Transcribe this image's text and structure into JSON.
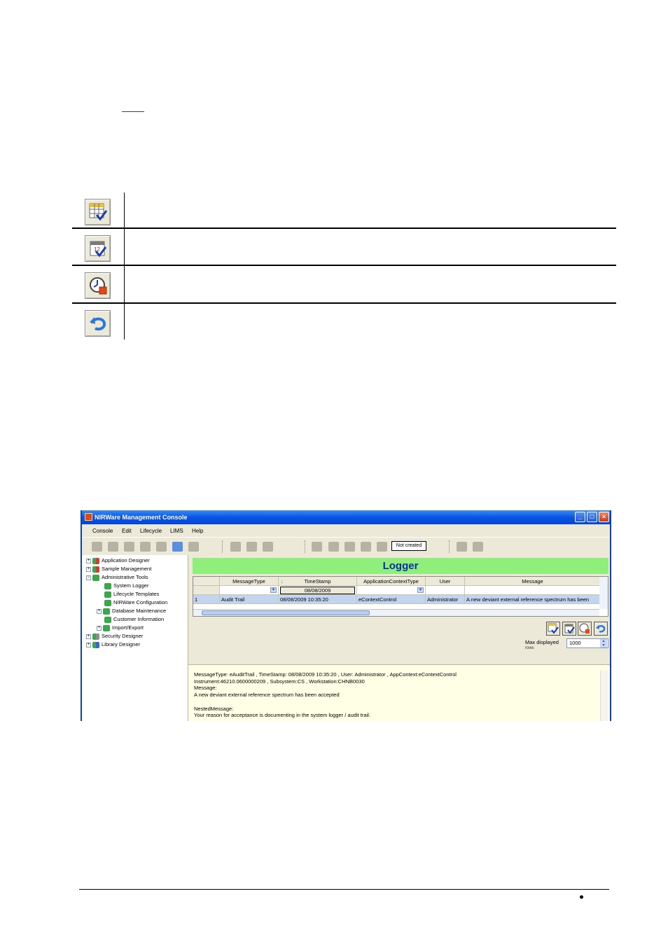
{
  "window": {
    "title": "NIRWare Management Console",
    "buttons": {
      "minimize": "_",
      "maximize": "□",
      "close": "×"
    }
  },
  "menu": [
    "Console",
    "Edit",
    "Lifecycle",
    "LIMS",
    "Help"
  ],
  "toolbar": {
    "status": "Not created"
  },
  "tree": [
    {
      "label": "Application Designer",
      "level": 0,
      "expander": "+",
      "icon": "puzzle-red"
    },
    {
      "label": "Sample Management",
      "level": 0,
      "expander": "+",
      "icon": "puzzle-red"
    },
    {
      "label": "Administrative Tools",
      "level": 0,
      "expander": "−",
      "icon": "puzzle-green"
    },
    {
      "label": "System Logger",
      "level": 1,
      "expander": "",
      "icon": "puzzle-green"
    },
    {
      "label": "Lifecycle Templates",
      "level": 1,
      "expander": "",
      "icon": "puzzle-green"
    },
    {
      "label": "NIRWare Configuration",
      "level": 1,
      "expander": "",
      "icon": "puzzle-green"
    },
    {
      "label": "Database Maintenance",
      "level": 1,
      "expander": "+",
      "icon": "puzzle-green"
    },
    {
      "label": "Customer Information",
      "level": 1,
      "expander": "",
      "icon": "puzzle-green"
    },
    {
      "label": "Import/Export",
      "level": 1,
      "expander": "+",
      "icon": "puzzle-green"
    },
    {
      "label": "Security Designer",
      "level": 0,
      "expander": "+",
      "icon": "puzzle-grey"
    },
    {
      "label": "Library Designer",
      "level": 0,
      "expander": "+",
      "icon": "puzzle-blue"
    }
  ],
  "logger": {
    "title": "Logger",
    "columns": [
      "MessageType",
      "TimeStamp",
      "ApplicationContextType",
      "User",
      "Message"
    ],
    "filter_date": "08/08/2009",
    "rows": [
      {
        "index": "1",
        "MessageType": "Audit Trail",
        "TimeStamp": "08/08/2009 10:35:20",
        "ApplicationContextType": "eContextControl",
        "User": "Administrator",
        "Message": "A new deviant external reference spectrum has been"
      }
    ],
    "max_rows_label": "Max displayed",
    "max_rows_sub": "rows",
    "max_rows_value": "1000"
  },
  "detail": [
    "MessageType: eAuditTrail , TimeStamp: 08/08/2009 10:35:20 , User: Administrator , AppContext:eContextControl",
    "Instrument:46210.0600000209 , Subsystem:CS , Workstation:CHNB0030",
    "Message:",
    "A new deviant external reference spectrum has been accepted",
    "",
    "NestedMessage:",
    "Your reason for acceptance is documenting in the system logger / audit trail."
  ],
  "icon_table_icons": [
    "grid-check-icon",
    "calendar-check-icon",
    "clock-stop-icon",
    "undo-arrow-icon"
  ]
}
